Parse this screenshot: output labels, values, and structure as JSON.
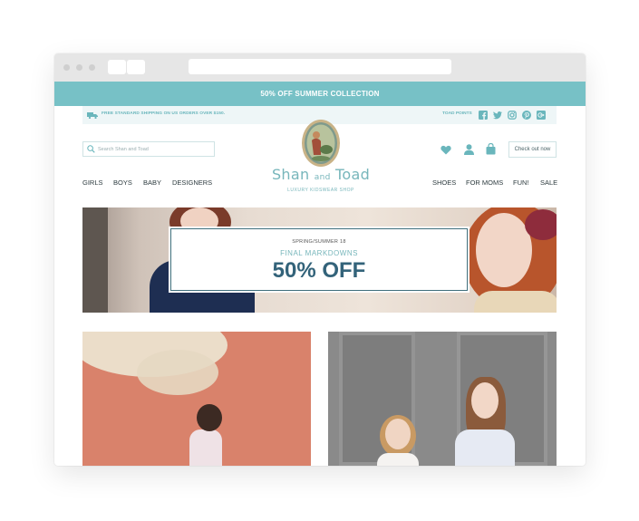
{
  "promo": {
    "text": "50% OFF SUMMER COLLECTION"
  },
  "info_bar": {
    "shipping_text": "FREE STANDARD SHIPPING ON US ORDERS OVER $150.",
    "points_label": "TOAD POINTS",
    "social_icons": [
      "facebook-icon",
      "twitter-icon",
      "instagram-icon",
      "pinterest-icon",
      "google-plus-icon"
    ]
  },
  "header": {
    "search_placeholder": "Search Shan and Toad",
    "brand_name_1": "Shan",
    "brand_name_and": "and",
    "brand_name_2": "Toad",
    "tagline": "LUXURY KIDSWEAR SHOP",
    "checkout_label": "Check out now",
    "icons": [
      "heart-icon",
      "user-icon",
      "bag-icon"
    ]
  },
  "nav": {
    "left": [
      "GIRLS",
      "BOYS",
      "BABY",
      "DESIGNERS"
    ],
    "right": [
      "SHOES",
      "FOR MOMS",
      "FUN!",
      "SALE"
    ]
  },
  "hero": {
    "season": "SPRING/SUMMER 18",
    "subtitle": "FINAL MARKDOWNS",
    "headline": "50% OFF"
  },
  "colors": {
    "accent": "#77c1c6",
    "headline": "#33637a",
    "nav_text": "#2d3b3f"
  }
}
